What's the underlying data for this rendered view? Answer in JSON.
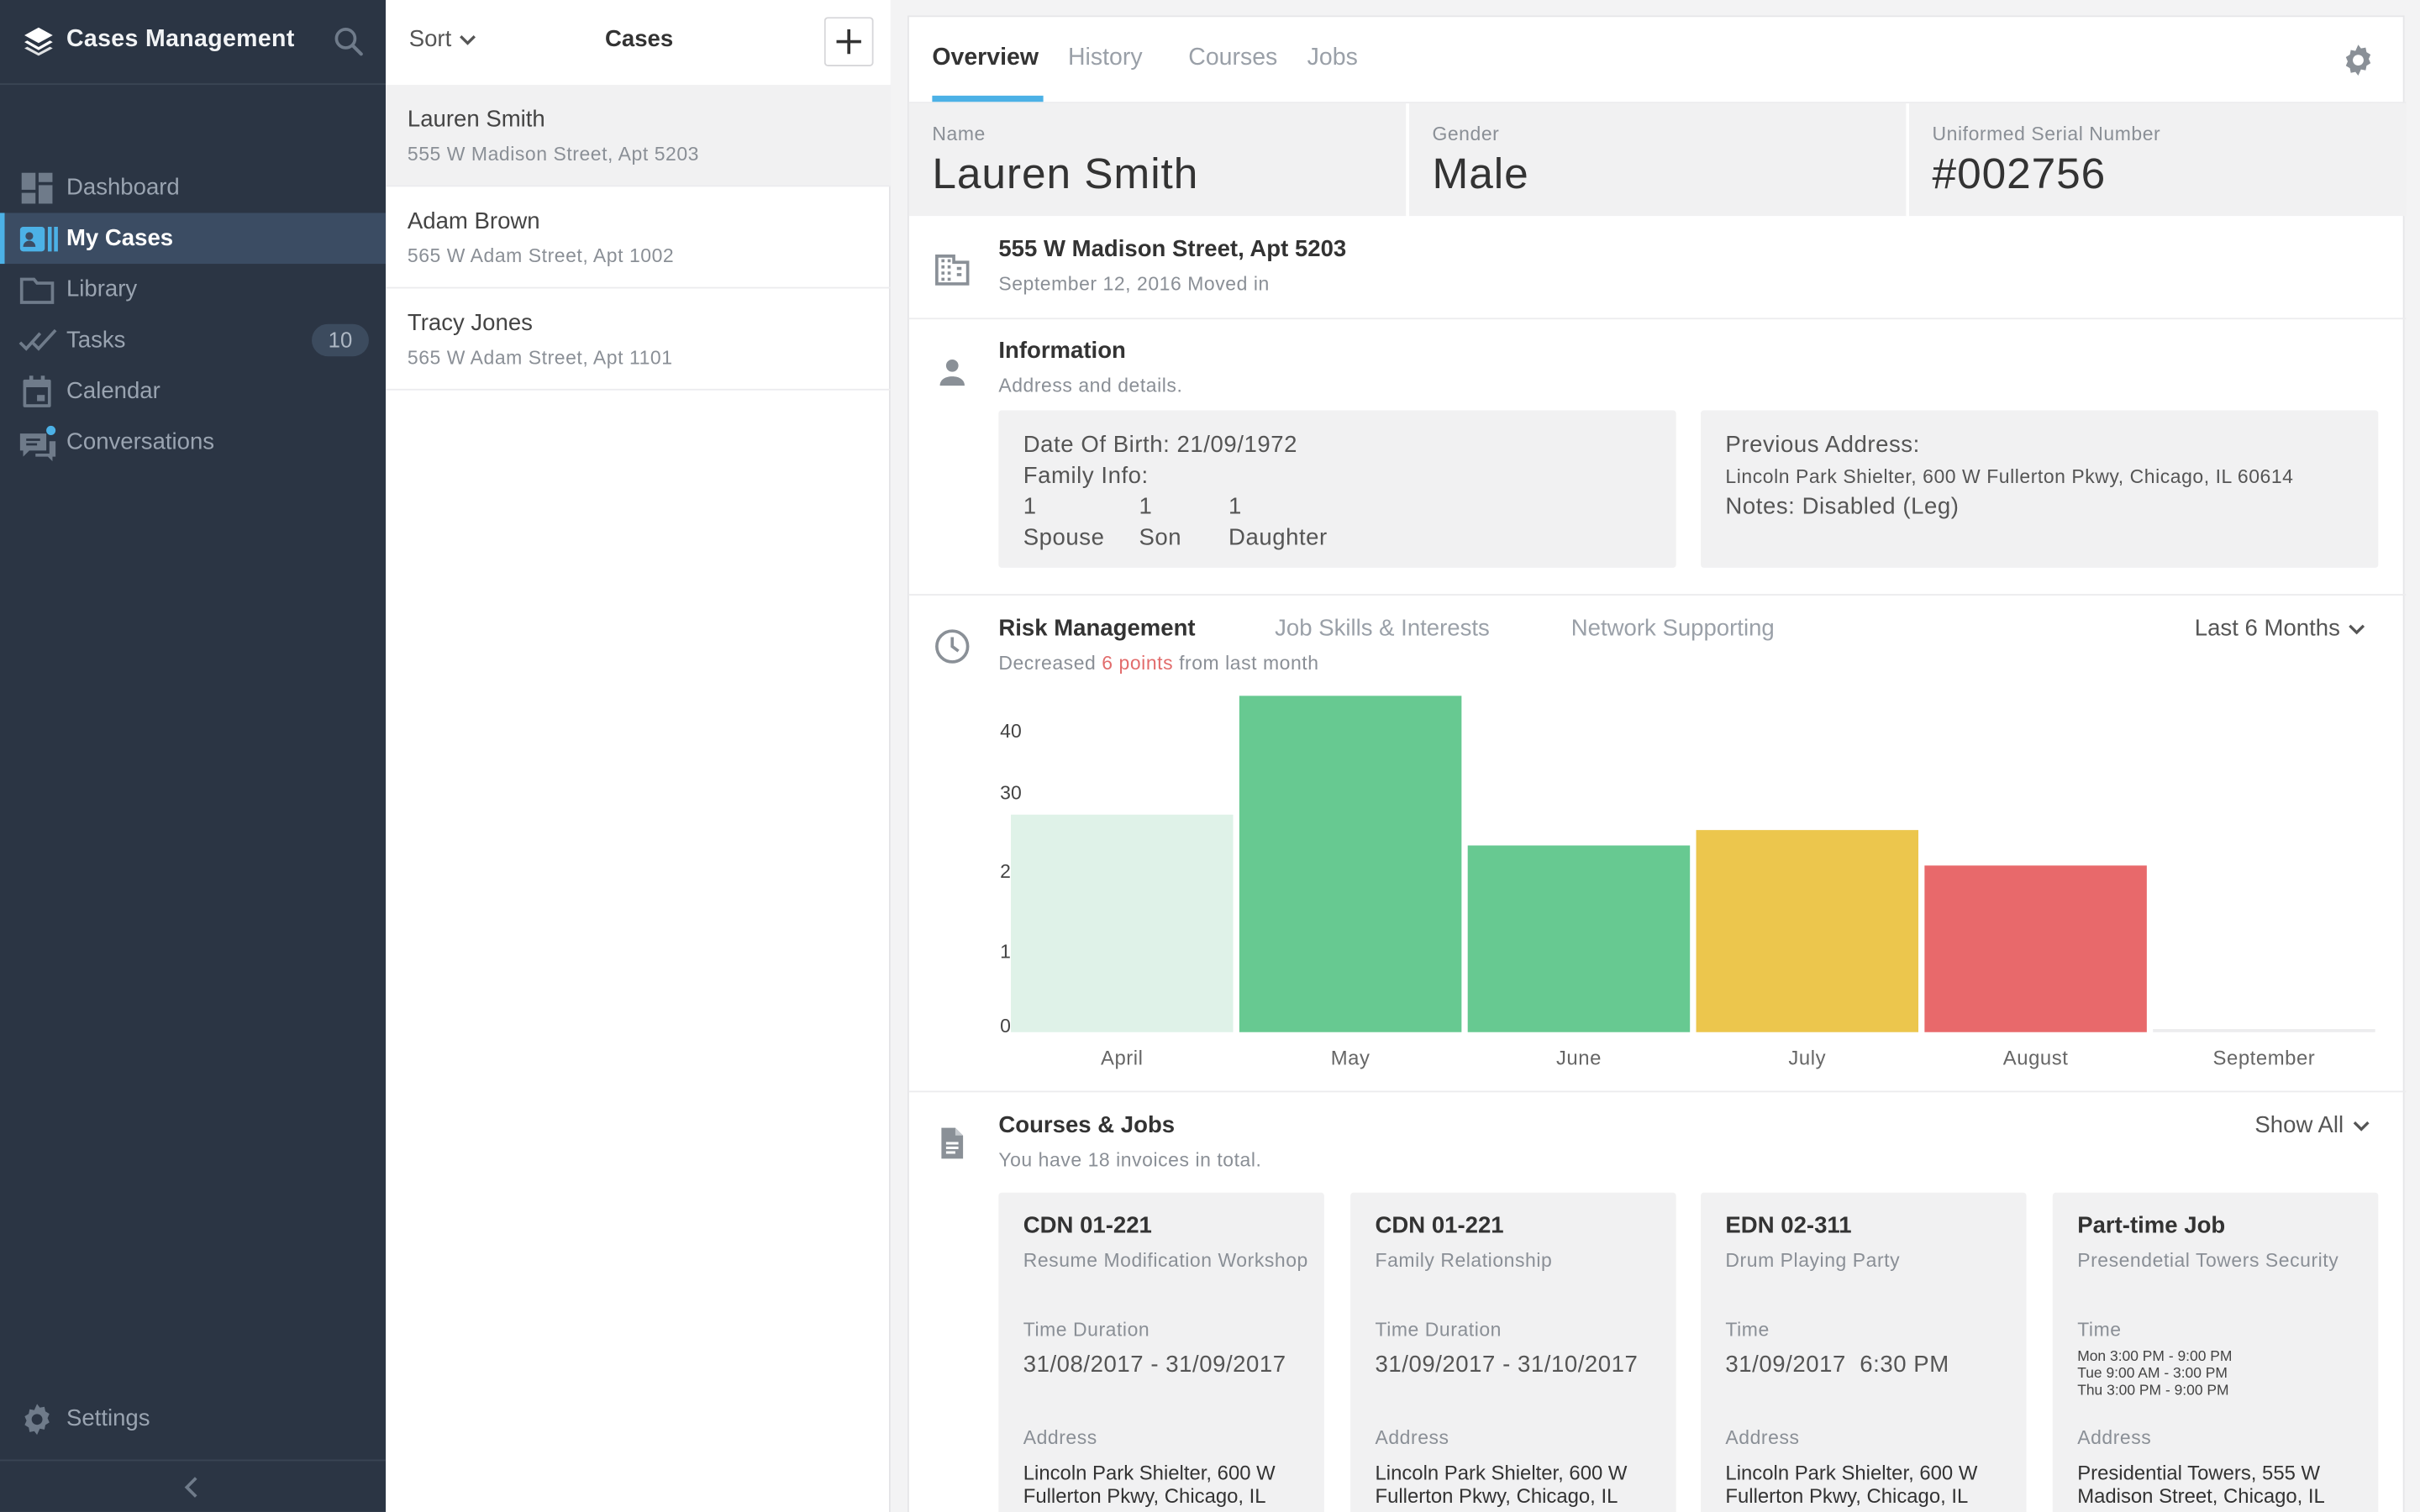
{
  "app": {
    "title": "Cases Management"
  },
  "sidebar": {
    "items": [
      {
        "label": "Dashboard",
        "icon": "dashboard-icon"
      },
      {
        "label": "My Cases",
        "icon": "cases-icon",
        "active": true
      },
      {
        "label": "Library",
        "icon": "folder-icon"
      },
      {
        "label": "Tasks",
        "icon": "tasks-icon",
        "badge": "10"
      },
      {
        "label": "Calendar",
        "icon": "calendar-icon"
      },
      {
        "label": "Conversations",
        "icon": "chat-icon"
      }
    ],
    "settings_label": "Settings"
  },
  "cases": {
    "sort_label": "Sort",
    "title": "Cases",
    "items": [
      {
        "name": "Lauren Smith",
        "address": "555 W Madison Street, Apt 5203"
      },
      {
        "name": "Adam Brown",
        "address": "565 W Adam Street, Apt 1002"
      },
      {
        "name": "Tracy Jones",
        "address": "565 W Adam Street, Apt 1101"
      }
    ]
  },
  "detail": {
    "tabs": [
      "Overview",
      "History",
      "Courses",
      "Jobs"
    ],
    "summary": {
      "name_label": "Name",
      "name": "Lauren Smith",
      "gender_label": "Gender",
      "gender": "Male",
      "serial_label": "Uniformed Serial Number",
      "serial": "#002756"
    },
    "address": {
      "title": "555 W Madison Street, Apt 5203",
      "sub": "September 12, 2016 Moved in"
    },
    "information": {
      "title": "Information",
      "sub": "Address and details.",
      "dob": "Date Of Birth: 21/09/1972",
      "family_label": "Family Info:",
      "family": [
        {
          "count": "1",
          "label": "Spouse"
        },
        {
          "count": "1",
          "label": "Son"
        },
        {
          "count": "1",
          "label": "Daughter"
        }
      ],
      "prev_label": "Previous Address:",
      "prev_address": "Lincoln Park Shielter, 600 W Fullerton Pkwy, Chicago, IL 60614",
      "notes": "Notes: Disabled (Leg)"
    },
    "risk": {
      "tabs": [
        "Risk Management",
        "Job Skills & Interests",
        "Network Supporting"
      ],
      "period": "Last 6 Months",
      "sub_prefix": "Decreased",
      "sub_value": "6 points",
      "sub_suffix": "from last month"
    },
    "courses": {
      "title": "Courses & Jobs",
      "sub": "You have 18 invoices in total.",
      "show_all": "Show All",
      "cards": [
        {
          "code": "CDN 01-221",
          "desc": "Resume Modification Workshop",
          "time_label": "Time Duration",
          "time": "31/08/2017 - 31/09/2017",
          "addr_label": "Address",
          "address": "Lincoln Park Shielter, 600 W Fullerton Pkwy, Chicago, IL"
        },
        {
          "code": "CDN 01-221",
          "desc": "Family Relationship",
          "time_label": "Time Duration",
          "time": "31/09/2017 - 31/10/2017",
          "addr_label": "Address",
          "address": "Lincoln Park Shielter, 600 W Fullerton Pkwy, Chicago, IL"
        },
        {
          "code": "EDN 02-311",
          "desc": "Drum Playing Party",
          "time_label": "Time",
          "time": "31/09/2017  6:30 PM",
          "addr_label": "Address",
          "address": "Lincoln Park Shielter, 600 W Fullerton Pkwy, Chicago, IL"
        },
        {
          "code": "Part-time Job",
          "desc": "Presendetial Towers Security",
          "time_label": "Time",
          "schedule": [
            "Mon 3:00 PM - 9:00 PM",
            "Tue 9:00 AM - 3:00 PM",
            "Thu 3:00 PM - 9:00 PM"
          ],
          "addr_label": "Address",
          "address": "Presidential Towers, 555 W Madison Street, Chicago, IL"
        }
      ]
    }
  },
  "colors": {
    "accent": "#4cb1e6",
    "sidebar": "#2b3544",
    "bar_light": "#dff2e8",
    "bar_green": "#67c991",
    "bar_yellow": "#ecc64d",
    "bar_red": "#e8696b"
  },
  "chart_data": {
    "type": "bar",
    "categories": [
      "April",
      "May",
      "June",
      "July",
      "August",
      "September"
    ],
    "values": [
      27.5,
      42.5,
      23.5,
      25.5,
      21,
      0
    ],
    "colors": [
      "#dff2e8",
      "#67c991",
      "#67c991",
      "#ecc64d",
      "#e8696b",
      "#ececee"
    ],
    "yticks": [
      0,
      10,
      20,
      30,
      40
    ],
    "ylim": [
      0,
      42.5
    ],
    "grid": false
  }
}
